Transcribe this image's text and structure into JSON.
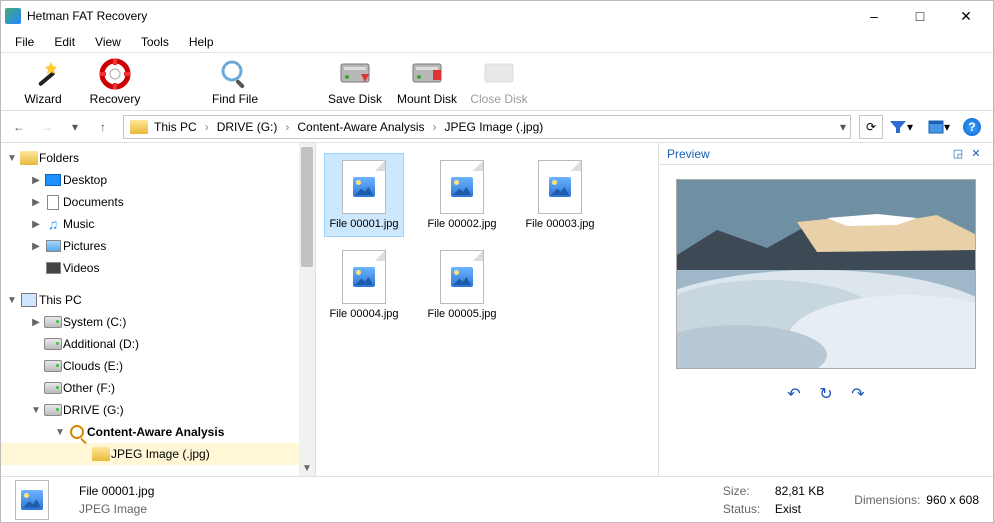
{
  "window": {
    "title": "Hetman FAT Recovery"
  },
  "menu": [
    "File",
    "Edit",
    "View",
    "Tools",
    "Help"
  ],
  "toolbar": {
    "wizard": "Wizard",
    "recovery": "Recovery",
    "find": "Find File",
    "save": "Save Disk",
    "mount": "Mount Disk",
    "close": "Close Disk"
  },
  "breadcrumb": [
    "This PC",
    "DRIVE (G:)",
    "Content-Aware Analysis",
    "JPEG Image (.jpg)"
  ],
  "tree": {
    "folders_root": "Folders",
    "desktop": "Desktop",
    "documents": "Documents",
    "music": "Music",
    "pictures": "Pictures",
    "videos": "Videos",
    "thispc": "This PC",
    "system": "System (C:)",
    "additional": "Additional (D:)",
    "clouds": "Clouds (E:)",
    "other": "Other (F:)",
    "drive": "DRIVE (G:)",
    "caa": "Content-Aware Analysis",
    "jpg": "JPEG Image (.jpg)"
  },
  "files": [
    {
      "name": "File 00001.jpg",
      "selected": true
    },
    {
      "name": "File 00002.jpg",
      "selected": false
    },
    {
      "name": "File 00003.jpg",
      "selected": false
    },
    {
      "name": "File 00004.jpg",
      "selected": false
    },
    {
      "name": "File 00005.jpg",
      "selected": false
    }
  ],
  "preview": {
    "title": "Preview"
  },
  "status": {
    "name": "File 00001.jpg",
    "type": "JPEG Image",
    "size_label": "Size:",
    "size": "82,81 KB",
    "status_label": "Status:",
    "status": "Exist",
    "dim_label": "Dimensions:",
    "dim": "960 x 608"
  }
}
